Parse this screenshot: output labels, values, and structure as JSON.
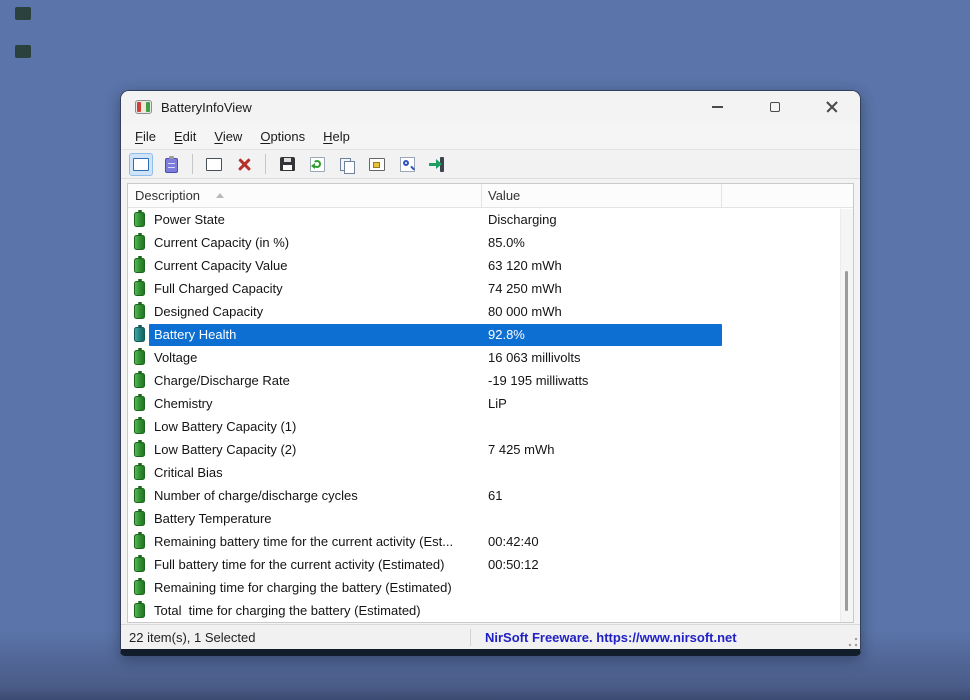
{
  "app": {
    "title": "BatteryInfoView"
  },
  "window_controls": [
    "minimize",
    "maximize",
    "close"
  ],
  "menu": {
    "items": [
      "File",
      "Edit",
      "View",
      "Options",
      "Help"
    ]
  },
  "toolbar": {
    "buttons": [
      "show-battery-info",
      "show-battery-log",
      "properties-window",
      "delete",
      "save",
      "refresh",
      "copy",
      "advanced-properties",
      "find",
      "exit"
    ],
    "active_button": "show-battery-info"
  },
  "table": {
    "columns": [
      "Description",
      "Value"
    ],
    "sort_column": "Description",
    "rows": [
      {
        "description": "Power State",
        "value": "Discharging",
        "selected": false
      },
      {
        "description": "Current Capacity (in %)",
        "value": "85.0%",
        "selected": false
      },
      {
        "description": "Current Capacity Value",
        "value": "63 120 mWh",
        "selected": false
      },
      {
        "description": "Full Charged Capacity",
        "value": "74 250 mWh",
        "selected": false
      },
      {
        "description": "Designed Capacity",
        "value": "80 000 mWh",
        "selected": false
      },
      {
        "description": "Battery Health",
        "value": "92.8%",
        "selected": true
      },
      {
        "description": "Voltage",
        "value": "16 063 millivolts",
        "selected": false
      },
      {
        "description": "Charge/Discharge Rate",
        "value": "-19 195 milliwatts",
        "selected": false
      },
      {
        "description": "Chemistry",
        "value": "LiP",
        "selected": false
      },
      {
        "description": "Low Battery Capacity (1)",
        "value": "",
        "selected": false
      },
      {
        "description": "Low Battery Capacity (2)",
        "value": "7 425 mWh",
        "selected": false
      },
      {
        "description": "Critical Bias",
        "value": "",
        "selected": false
      },
      {
        "description": "Number of charge/discharge cycles",
        "value": "61",
        "selected": false
      },
      {
        "description": "Battery Temperature",
        "value": "",
        "selected": false
      },
      {
        "description": "Remaining battery time for the current activity (Est...",
        "value": "00:42:40",
        "selected": false
      },
      {
        "description": "Full battery time for the current activity (Estimated)",
        "value": "00:50:12",
        "selected": false
      },
      {
        "description": "Remaining time for charging the battery (Estimated)",
        "value": "",
        "selected": false
      },
      {
        "description": "Total  time for charging the battery (Estimated)",
        "value": "",
        "selected": false
      }
    ]
  },
  "statusbar": {
    "items_text": "22 item(s), 1 Selected",
    "website_text": "NirSoft Freeware. https://www.nirsoft.net"
  },
  "colors": {
    "desktop": "#5b74a9",
    "selection": "#0d6fd2",
    "link_text": "#2121c4",
    "battery_icon": "#2f8f31"
  }
}
